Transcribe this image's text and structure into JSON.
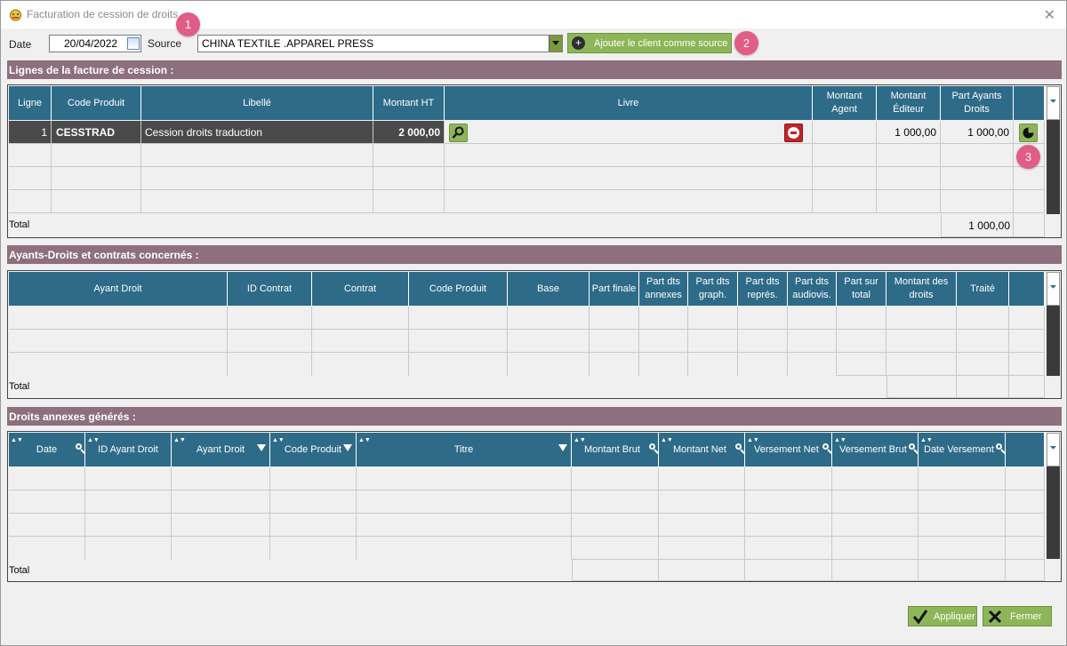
{
  "window": {
    "title": "Facturation de cession de droits"
  },
  "markers": [
    "1",
    "2",
    "3"
  ],
  "form": {
    "date_label": "Date",
    "date_value": "20/04/2022",
    "source_label": "Source",
    "source_value": "CHINA TEXTILE .APPAREL PRESS",
    "add_client_label": "Ajouter le client comme source"
  },
  "lignes": {
    "section_title": "Lignes de la facture de cession :",
    "headers": [
      "Ligne",
      "Code Produit",
      "Libellé",
      "Montant HT",
      "Livre",
      "Montant Agent",
      "Montant Éditeur",
      "Part Ayants Droits"
    ],
    "rows": [
      {
        "ligne": "1",
        "code": "CESSTRAD",
        "libelle": "Cession droits traduction",
        "montant_ht": "2 000,00",
        "livre": "",
        "agent": "",
        "editeur": "1 000,00",
        "part": "1 000,00"
      }
    ],
    "total_label": "Total",
    "total_part": "1 000,00"
  },
  "ayants": {
    "section_title": "Ayants-Droits et contrats concernés :",
    "headers": [
      "Ayant Droit",
      "ID Contrat",
      "Contrat",
      "Code Produit",
      "Base",
      "Part finale",
      "Part dts annexes",
      "Part dts graph.",
      "Part dts représ.",
      "Part dts audiovis.",
      "Part sur total",
      "Montant des droits",
      "Traité"
    ],
    "total_label": "Total"
  },
  "annexes": {
    "section_title": "Droits annexes générés :",
    "headers": [
      "Date",
      "ID Ayant Droit",
      "Ayant Droit",
      "Code Produit",
      "Titre",
      "Montant Brut",
      "Montant Net",
      "Versement Net",
      "Versement Brut",
      "Date Versement"
    ],
    "total_label": "Total"
  },
  "footer": {
    "apply_label": "Appliquer",
    "close_label": "Fermer"
  },
  "colors": {
    "header": "#2e6b88",
    "section": "#8d6f7e",
    "accent_green": "#8db658",
    "marker": "#e15c86"
  }
}
